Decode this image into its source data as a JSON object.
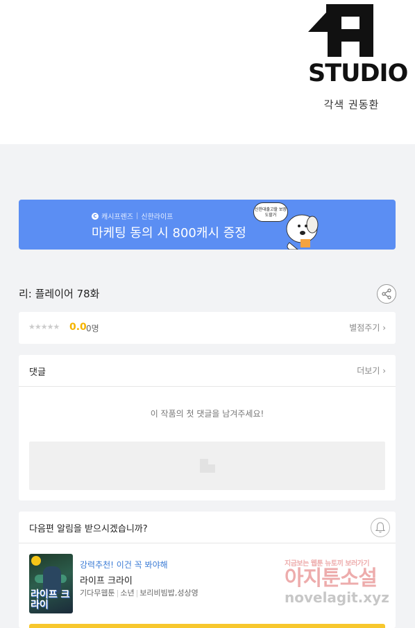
{
  "header": {
    "studio_name": "STUDIO",
    "credit": "각색 권동환"
  },
  "banner": {
    "sponsor_brand": "캐시프렌즈",
    "sponsor_partner": "신한라이프",
    "title": "마케팅 동의 시 800캐시 증정",
    "bubble_text": "신한대출고할 보장도할거"
  },
  "episode": {
    "title": "리: 플레이어 78화"
  },
  "rating": {
    "stars": "★★★★★",
    "score": "0.0",
    "count": "0명",
    "rate_link": "별점주기 ›"
  },
  "comments": {
    "label": "댓글",
    "more": "더보기 ›",
    "empty_message": "이 작품의 첫 댓글을 남겨주세요!"
  },
  "subscribe": {
    "question": "다음편 알림을 받으시겠습니까?"
  },
  "recommendation": {
    "tag": "강력추천! 이건 꼭 봐야해",
    "title": "라이프 크라이",
    "thumb_title": "라이프 크라이",
    "meta": [
      "기다무웹툰",
      "소년",
      "보리비빔밥,성상영"
    ]
  },
  "watermark": {
    "top": "지금보는 웹툰 뉴토끼 보러가기",
    "main": "아지툰소설",
    "url": "novelagit.xyz"
  }
}
